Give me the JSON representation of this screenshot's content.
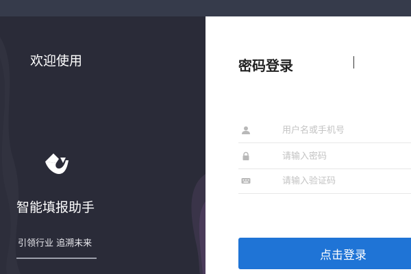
{
  "left": {
    "welcome": "欢迎使用",
    "brand": "智能填报助手",
    "slogan": "引领行业 追溯未来"
  },
  "login": {
    "title": "密码登录",
    "username_placeholder": "用户名或手机号",
    "password_placeholder": "请输入密码",
    "captcha_placeholder": "请输入验证码",
    "submit_label": "点击登录"
  },
  "colors": {
    "left_bg": "#2a2b38",
    "accent": "#1f74d6",
    "topbar": "#363b4b"
  },
  "icons": [
    "user-icon",
    "lock-icon",
    "keyboard-icon",
    "app-logo-icon"
  ]
}
